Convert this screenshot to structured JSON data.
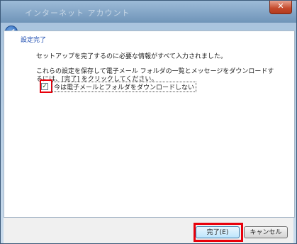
{
  "window": {
    "title": "インターネット アカウント",
    "close_label": "✕",
    "back_label": "◀"
  },
  "page": {
    "heading": "設定完了",
    "message1": "セットアップを完了するのに必要な情報がすべて入力されました。",
    "message2": "これらの設定を保存して電子メール フォルダの一覧とメッセージをダウンロードするには、[完了] をクリックしてください。",
    "checkbox_label": "今は電子メールとフォルダをダウンロードしない",
    "checkbox_checked": true,
    "checkbox_mark": "✓"
  },
  "buttons": {
    "finish": "完了(E)",
    "cancel": "キャンセル"
  },
  "highlight_color": "#e8000b"
}
